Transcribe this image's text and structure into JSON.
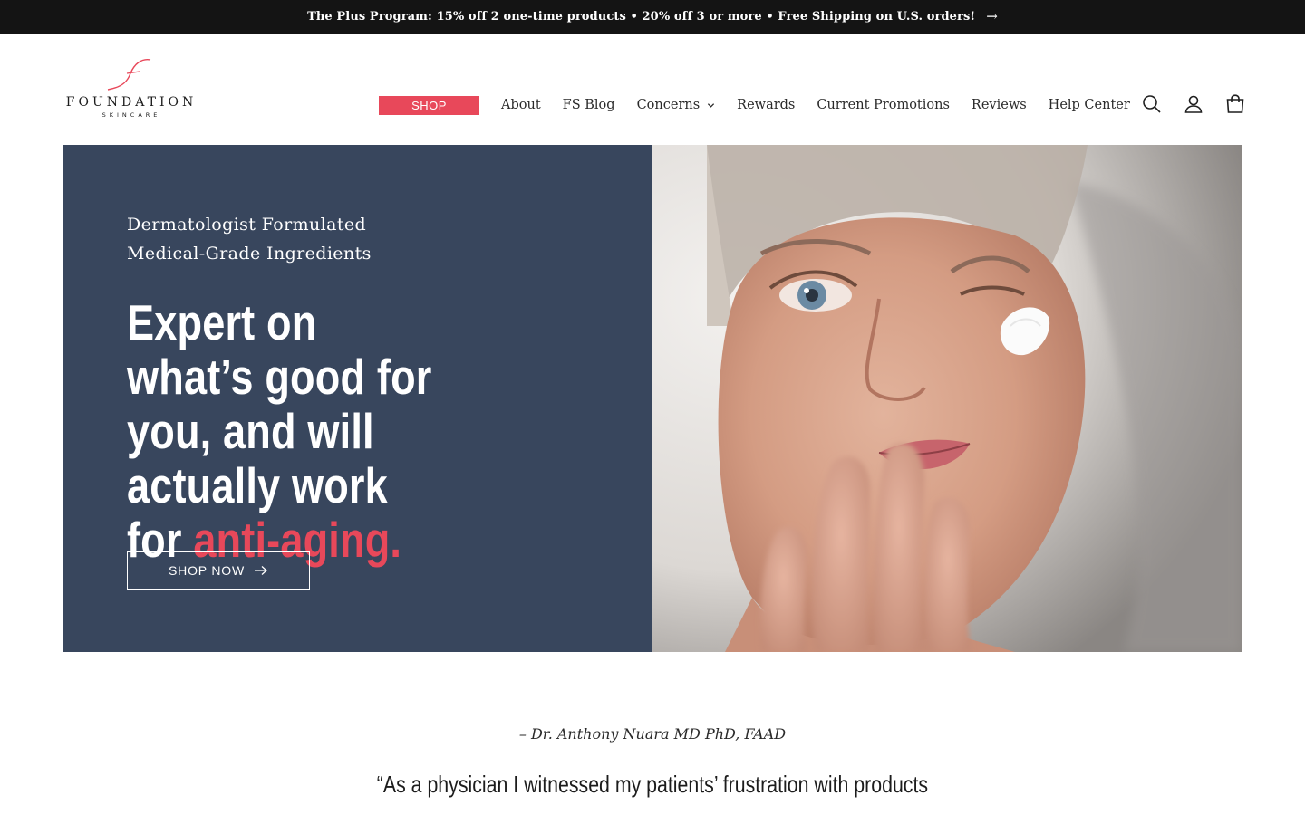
{
  "announcement": {
    "text": "The Plus Program: 15% off 2 one-time products • 20% off 3 or more • Free Shipping on U.S. orders!",
    "arrow_icon": "arrow-right-icon"
  },
  "header": {
    "logo": {
      "wordmark": "FOUNDATION",
      "subtext": "SKINCARE",
      "script_letter": "f"
    },
    "nav": {
      "shop_label": "SHOP",
      "links": [
        "About",
        "FS Blog",
        "Concerns",
        "Rewards",
        "Current Promotions",
        "Reviews",
        "Help Center"
      ]
    },
    "icons": [
      "search-icon",
      "account-icon",
      "cart-icon"
    ]
  },
  "hero": {
    "subtitle_line1": "Dermatologist Formulated",
    "subtitle_line2": "Medical-Grade Ingredients",
    "title_main": "Expert on what’s good for you, and will actually work for ",
    "title_accent": "anti-aging.",
    "cta_label": "SHOP NOW"
  },
  "testimonial": {
    "author": "– Dr. Anthony Nuara MD PhD, FAAD",
    "quote": "“As a physician I witnessed my patients’ frustration with products"
  },
  "colors": {
    "accent": "#e8485a",
    "hero_bg": "#38465d",
    "announcement_bg": "#141414"
  }
}
